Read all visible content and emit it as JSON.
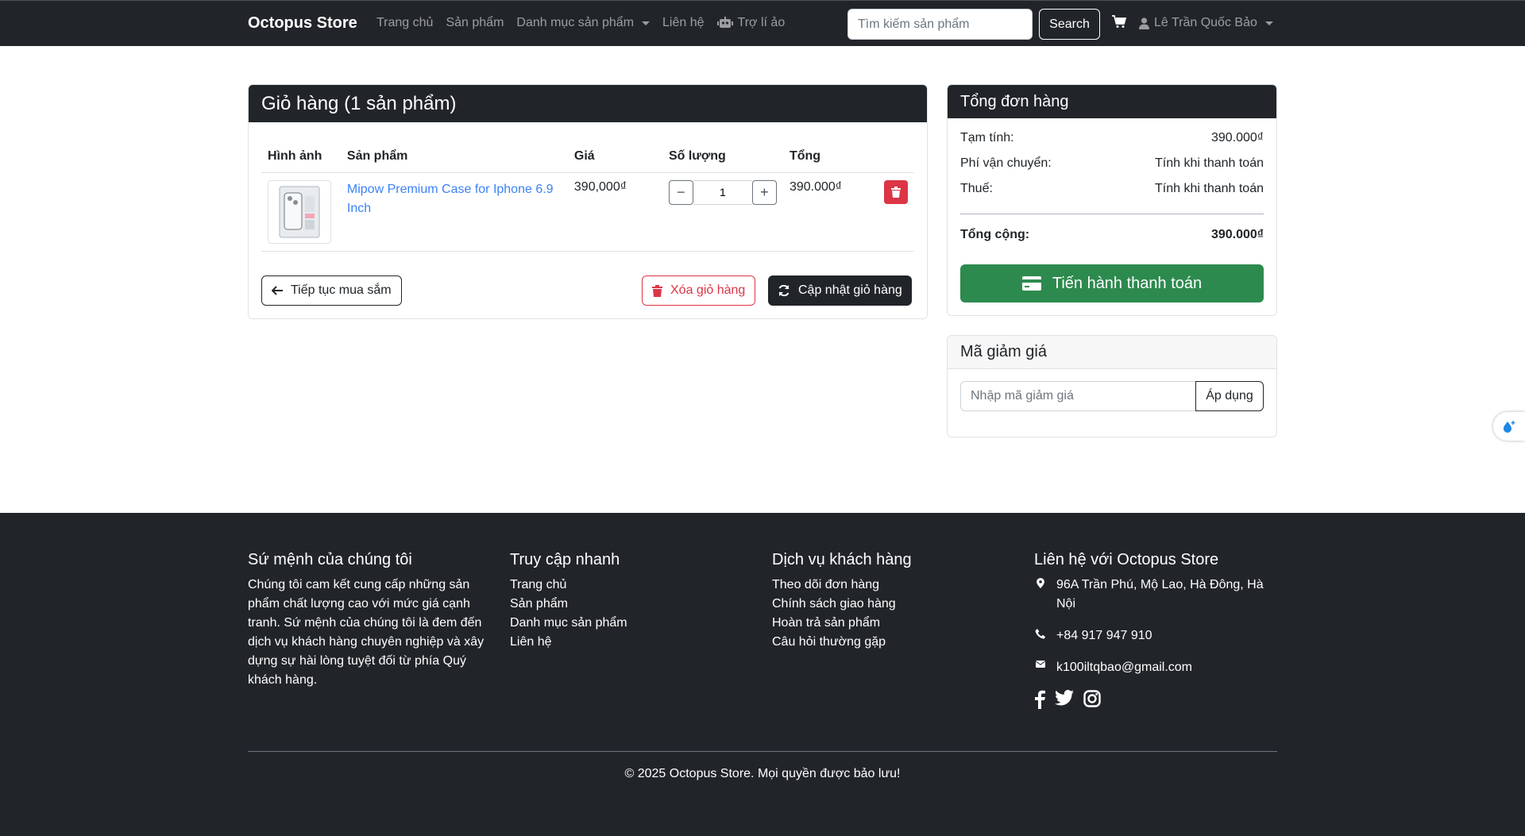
{
  "header": {
    "brand": "Octopus Store",
    "nav": [
      {
        "label": "Trang chủ"
      },
      {
        "label": "Sản phẩm"
      },
      {
        "label": "Danh mục sản phẩm"
      },
      {
        "label": "Liên hệ"
      },
      {
        "label": "Trợ lí ảo"
      }
    ],
    "search_placeholder": "Tìm kiếm sản phẩm",
    "search_button": "Search",
    "user_name": "Lê Trần Quốc Bảo"
  },
  "cart": {
    "title": "Giỏ hàng (1 sản phẩm)",
    "columns": [
      "Hình ảnh",
      "Sản phẩm",
      "Giá",
      "Số lượng",
      "Tổng"
    ],
    "items": [
      {
        "name": "Mipow Premium Case for Iphone 6.9 Inch",
        "price": "390,000₫",
        "quantity": "1",
        "total": "390.000₫"
      }
    ],
    "continue_label": "Tiếp tục mua sắm",
    "clear_label": "Xóa giỏ hàng",
    "update_label": "Cập nhật giỏ hàng"
  },
  "summary": {
    "title": "Tổng đơn hàng",
    "subtotal_label": "Tạm tính:",
    "subtotal_value": "390.000₫",
    "shipping_label": "Phí vận chuyển:",
    "shipping_value": "Tính khi thanh toán",
    "tax_label": "Thuế:",
    "tax_value": "Tính khi thanh toán",
    "total_label": "Tổng cộng:",
    "total_value": "390.000₫",
    "checkout_label": "Tiến hành thanh toán"
  },
  "coupon": {
    "title": "Mã giảm giá",
    "placeholder": "Nhập mã giảm giá",
    "apply_label": "Áp dụng"
  },
  "footer": {
    "mission_title": "Sứ mệnh của chúng tôi",
    "mission_text": "Chúng tôi cam kết cung cấp những sản phẩm chất lượng cao với mức giá cạnh tranh. Sứ mệnh của chúng tôi là đem đến dịch vụ khách hàng chuyên nghiệp và xây dựng sự hài lòng tuyệt đối từ phía Quý khách hàng.",
    "quick_title": "Truy cập nhanh",
    "quick_links": [
      "Trang chủ",
      "Sản phẩm",
      "Danh mục sản phẩm",
      "Liên hệ"
    ],
    "service_title": "Dịch vụ khách hàng",
    "service_links": [
      "Theo dõi đơn hàng",
      "Chính sách giao hàng",
      "Hoàn trả sản phẩm",
      "Câu hỏi thường gặp"
    ],
    "contact_title": "Liên hệ với Octopus Store",
    "address": "96A Trần Phú, Mộ Lao, Hà Đông, Hà Nội",
    "phone": "+84 917 947 910",
    "email": "k100iltqbao@gmail.com",
    "copyright": "© 2025 Octopus Store. Mọi quyền được bảo lưu!"
  },
  "colors": {
    "dark": "#212529",
    "link": "#3b82f6",
    "danger": "#dc3545",
    "success": "#2d8a4e"
  },
  "icons": [
    "robot-icon",
    "cart-icon",
    "user-icon",
    "arrow-left-icon",
    "trash-icon",
    "refresh-icon",
    "credit-card-icon",
    "map-marker-icon",
    "phone-icon",
    "envelope-icon",
    "facebook-icon",
    "twitter-icon",
    "instagram-icon"
  ]
}
